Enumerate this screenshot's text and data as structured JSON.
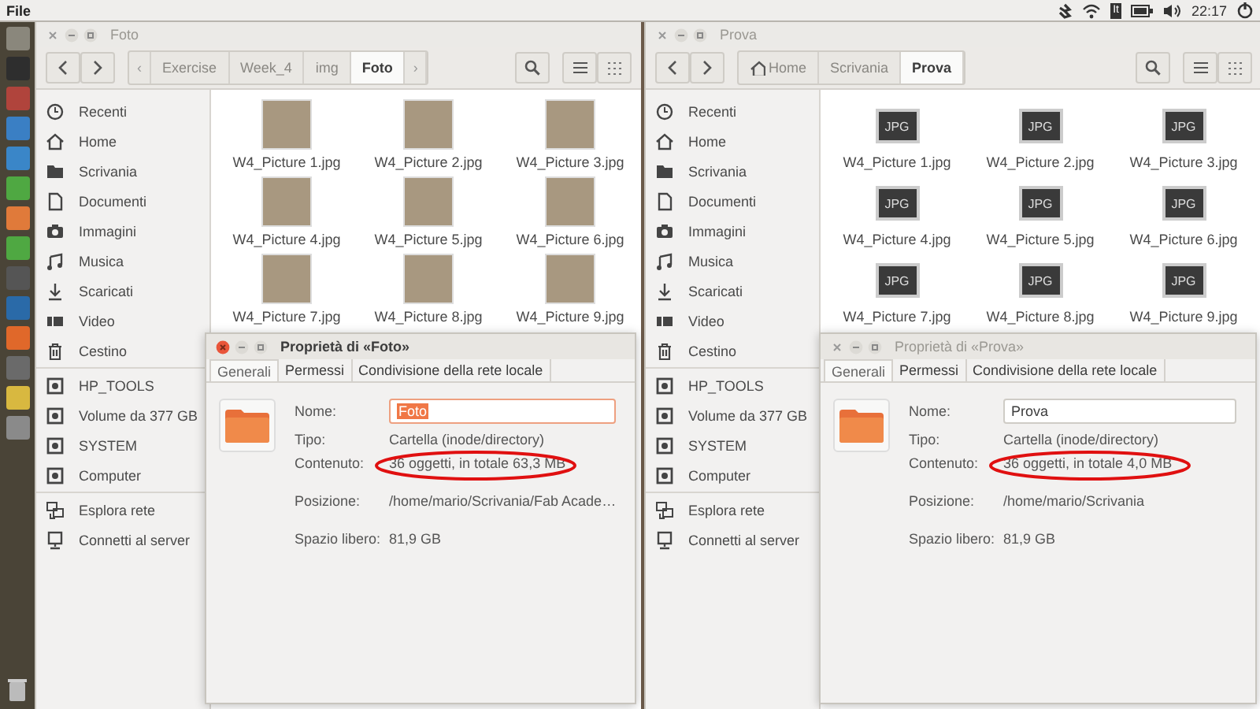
{
  "top_bar": {
    "menu": "File",
    "keyboard": "It",
    "clock": "22:17"
  },
  "launcher": [
    {
      "color": "#8a877c"
    },
    {
      "color": "#2e2e2e"
    },
    {
      "color": "#b0443c"
    },
    {
      "color": "#3a7fc4"
    },
    {
      "color": "#3a86c8"
    },
    {
      "color": "#4fa842"
    },
    {
      "color": "#e07a3a"
    },
    {
      "color": "#4fa842"
    },
    {
      "color": "#555555"
    },
    {
      "color": "#2a6aa8"
    },
    {
      "color": "#e0682a"
    },
    {
      "color": "#6a6a6a"
    },
    {
      "color": "#d8b840"
    },
    {
      "color": "#8a8a8a"
    }
  ],
  "windows": [
    {
      "title": "Foto",
      "scroll_left": "‹",
      "scroll_right": "›",
      "path": [
        {
          "label": "Exercise",
          "kind": "text",
          "selected": false
        },
        {
          "label": "Week_4",
          "kind": "text",
          "selected": false
        },
        {
          "label": "img",
          "kind": "text",
          "selected": false
        },
        {
          "label": "Foto",
          "kind": "text",
          "selected": true
        }
      ],
      "sidebar": [
        [
          {
            "label": "Recenti",
            "kind": "recent"
          },
          {
            "label": "Home",
            "kind": "home"
          },
          {
            "label": "Scrivania",
            "kind": "folder"
          },
          {
            "label": "Documenti",
            "kind": "document"
          },
          {
            "label": "Immagini",
            "kind": "camera"
          },
          {
            "label": "Musica",
            "kind": "music"
          },
          {
            "label": "Scaricati",
            "kind": "download"
          },
          {
            "label": "Video",
            "kind": "video"
          },
          {
            "label": "Cestino",
            "kind": "trash"
          }
        ],
        [
          {
            "label": "HP_TOOLS",
            "kind": "drive"
          },
          {
            "label": "Volume da 377 GB",
            "kind": "drive"
          },
          {
            "label": "SYSTEM",
            "kind": "drive"
          },
          {
            "label": "Computer",
            "kind": "drive"
          }
        ],
        [
          {
            "label": "Esplora rete",
            "kind": "network"
          },
          {
            "label": "Connetti al server",
            "kind": "server"
          }
        ]
      ],
      "files": [
        {
          "name": "W4_Picture 1.jpg",
          "kind": "photo"
        },
        {
          "name": "W4_Picture 2.jpg",
          "kind": "photo"
        },
        {
          "name": "W4_Picture 3.jpg",
          "kind": "photo"
        },
        {
          "name": "W4_Picture 4.jpg",
          "kind": "photo"
        },
        {
          "name": "W4_Picture 5.jpg",
          "kind": "photo"
        },
        {
          "name": "W4_Picture 6.jpg",
          "kind": "photo"
        },
        {
          "name": "W4_Picture 7.jpg",
          "kind": "photo"
        },
        {
          "name": "W4_Picture 8.jpg",
          "kind": "photo"
        },
        {
          "name": "W4_Picture 9.jpg",
          "kind": "photo"
        }
      ],
      "dialog": {
        "title": "Proprietà di «Foto»",
        "active": true,
        "tabs": [
          {
            "label": "Generali",
            "selected": true
          },
          {
            "label": "Permessi",
            "selected": false
          },
          {
            "label": "Condivisione della rete locale",
            "selected": false
          }
        ],
        "groups": [
          [
            {
              "label": "Nome:",
              "value": "Foto",
              "kind": "input",
              "focused": true
            },
            {
              "label": "Tipo:",
              "value": "Cartella (inode/directory)",
              "kind": "text"
            },
            {
              "label": "Contenuto:",
              "value": "36 oggetti, in totale 63,3 MB",
              "kind": "text",
              "circled": true
            }
          ],
          [
            {
              "label": "Posizione:",
              "value": "/home/mario/Scrivania/Fab Acade…",
              "kind": "text"
            }
          ],
          [
            {
              "label": "Spazio libero:",
              "value": "81,9 GB",
              "kind": "text"
            }
          ]
        ]
      }
    },
    {
      "title": "Prova",
      "path": [
        {
          "label": "Home",
          "kind": "home",
          "selected": false
        },
        {
          "label": "Scrivania",
          "kind": "text",
          "selected": false
        },
        {
          "label": "Prova",
          "kind": "text",
          "selected": true
        }
      ],
      "sidebar": [
        [
          {
            "label": "Recenti",
            "kind": "recent"
          },
          {
            "label": "Home",
            "kind": "home"
          },
          {
            "label": "Scrivania",
            "kind": "folder"
          },
          {
            "label": "Documenti",
            "kind": "document"
          },
          {
            "label": "Immagini",
            "kind": "camera"
          },
          {
            "label": "Musica",
            "kind": "music"
          },
          {
            "label": "Scaricati",
            "kind": "download"
          },
          {
            "label": "Video",
            "kind": "video"
          },
          {
            "label": "Cestino",
            "kind": "trash"
          }
        ],
        [
          {
            "label": "HP_TOOLS",
            "kind": "drive"
          },
          {
            "label": "Volume da 377 GB",
            "kind": "drive"
          },
          {
            "label": "SYSTEM",
            "kind": "drive"
          },
          {
            "label": "Computer",
            "kind": "drive"
          }
        ],
        [
          {
            "label": "Esplora rete",
            "kind": "network"
          },
          {
            "label": "Connetti al server",
            "kind": "server"
          }
        ]
      ],
      "files": [
        {
          "name": "W4_Picture 1.jpg",
          "kind": "jpg",
          "badge": "JPG"
        },
        {
          "name": "W4_Picture 2.jpg",
          "kind": "jpg",
          "badge": "JPG"
        },
        {
          "name": "W4_Picture 3.jpg",
          "kind": "jpg",
          "badge": "JPG"
        },
        {
          "name": "W4_Picture 4.jpg",
          "kind": "jpg",
          "badge": "JPG"
        },
        {
          "name": "W4_Picture 5.jpg",
          "kind": "jpg",
          "badge": "JPG"
        },
        {
          "name": "W4_Picture 6.jpg",
          "kind": "jpg",
          "badge": "JPG"
        },
        {
          "name": "W4_Picture 7.jpg",
          "kind": "jpg",
          "badge": "JPG"
        },
        {
          "name": "W4_Picture 8.jpg",
          "kind": "jpg",
          "badge": "JPG"
        },
        {
          "name": "W4_Picture 9.jpg",
          "kind": "jpg",
          "badge": "JPG"
        }
      ],
      "dialog": {
        "title": "Proprietà di «Prova»",
        "active": false,
        "tabs": [
          {
            "label": "Generali",
            "selected": true
          },
          {
            "label": "Permessi",
            "selected": false
          },
          {
            "label": "Condivisione della rete locale",
            "selected": false
          }
        ],
        "groups": [
          [
            {
              "label": "Nome:",
              "value": "Prova",
              "kind": "input",
              "focused": false
            },
            {
              "label": "Tipo:",
              "value": "Cartella (inode/directory)",
              "kind": "text"
            },
            {
              "label": "Contenuto:",
              "value": "36 oggetti, in totale 4,0 MB",
              "kind": "text",
              "circled": true
            }
          ],
          [
            {
              "label": "Posizione:",
              "value": "/home/mario/Scrivania",
              "kind": "text"
            }
          ],
          [
            {
              "label": "Spazio libero:",
              "value": "81,9 GB",
              "kind": "text"
            }
          ]
        ]
      }
    }
  ]
}
